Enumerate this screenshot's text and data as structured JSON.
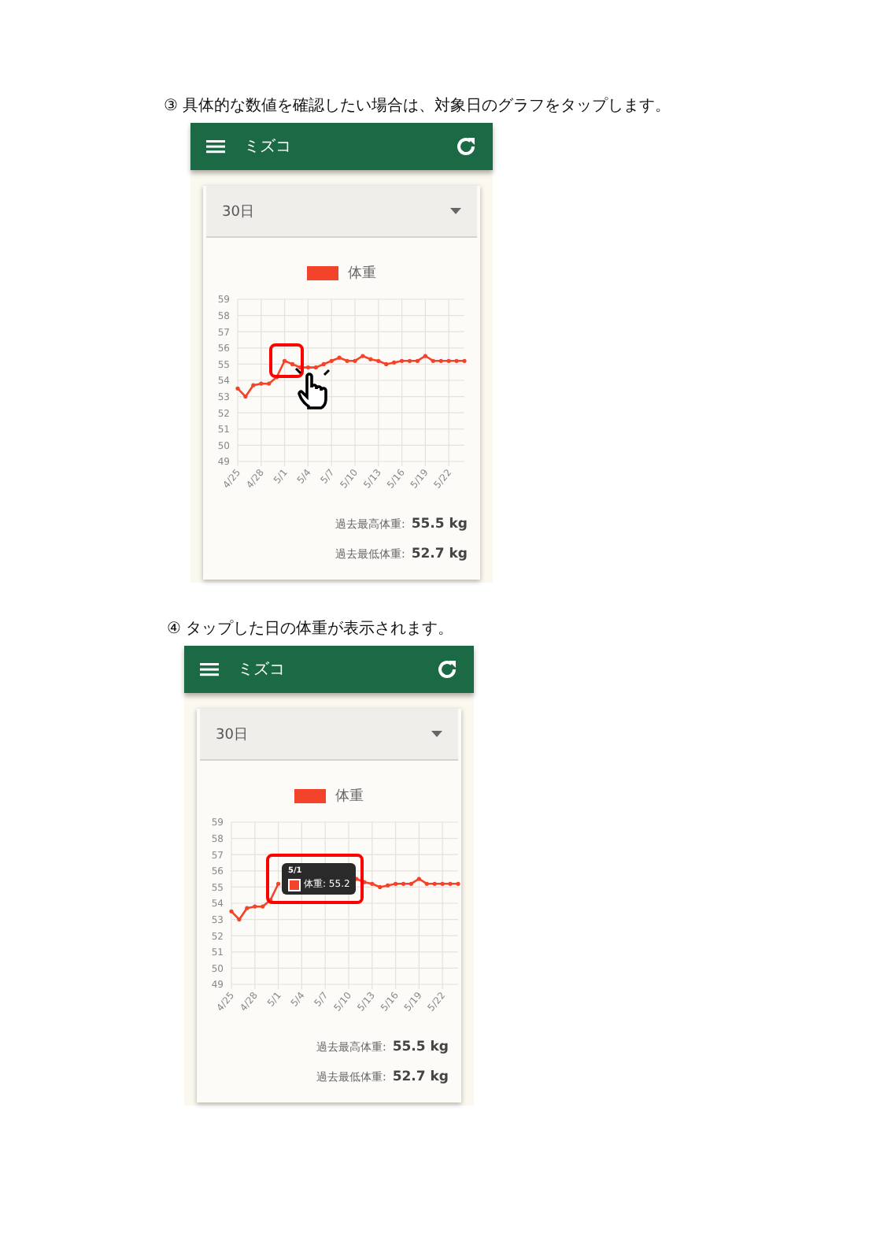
{
  "steps": [
    {
      "caption": "③ 具体的な数値を確認したい場合は、対象日のグラフをタップします。",
      "app": {
        "title": "ミズコ",
        "period": "30日",
        "chart_data": {
          "type": "line",
          "grid": true,
          "categories": [
            "4/25",
            null,
            null,
            "4/28",
            null,
            null,
            "5/1",
            null,
            null,
            "5/4",
            null,
            null,
            "5/7",
            null,
            null,
            "5/10",
            null,
            null,
            "5/13",
            null,
            null,
            "5/16",
            null,
            null,
            "5/19",
            null,
            null,
            "5/22",
            null,
            null
          ],
          "yticks": [
            49,
            50,
            51,
            52,
            53,
            54,
            55,
            56,
            57,
            58,
            59
          ],
          "ylim": [
            49,
            59
          ],
          "series": [
            {
              "name": "体重",
              "color": "#f4432b",
              "values": [
                53.5,
                53.0,
                53.7,
                53.8,
                53.8,
                54.2,
                55.2,
                55.0,
                54.8,
                54.8,
                54.8,
                55.0,
                55.2,
                55.4,
                55.2,
                55.2,
                55.5,
                55.3,
                55.2,
                55.0,
                55.1,
                55.2,
                55.2,
                55.2,
                55.5,
                55.2,
                55.2,
                55.2,
                55.2,
                55.2
              ]
            }
          ]
        },
        "stats": [
          {
            "label": "過去最高体重:",
            "value": "55.5 kg"
          },
          {
            "label": "過去最低体重:",
            "value": "52.7 kg"
          }
        ]
      },
      "callout": {
        "kind": "hand"
      }
    },
    {
      "caption": "④ タップした日の体重が表示されます。",
      "app": {
        "title": "ミズコ",
        "period": "30日",
        "chart_data": {
          "type": "line",
          "grid": true,
          "categories": [
            "4/25",
            null,
            null,
            "4/28",
            null,
            null,
            "5/1",
            null,
            null,
            "5/4",
            null,
            null,
            "5/7",
            null,
            null,
            "5/10",
            null,
            null,
            "5/13",
            null,
            null,
            "5/16",
            null,
            null,
            "5/19",
            null,
            null,
            "5/22",
            null,
            null
          ],
          "yticks": [
            49,
            50,
            51,
            52,
            53,
            54,
            55,
            56,
            57,
            58,
            59
          ],
          "ylim": [
            49,
            59
          ],
          "series": [
            {
              "name": "体重",
              "color": "#f4432b",
              "values": [
                53.5,
                53.0,
                53.7,
                53.8,
                53.8,
                54.2,
                55.2,
                null,
                null,
                null,
                null,
                null,
                null,
                null,
                null,
                null,
                55.5,
                55.3,
                55.2,
                55.0,
                55.1,
                55.2,
                55.2,
                55.2,
                55.5,
                55.2,
                55.2,
                55.2,
                55.2,
                55.2
              ]
            }
          ]
        },
        "stats": [
          {
            "label": "過去最高体重:",
            "value": "55.5 kg"
          },
          {
            "label": "過去最低体重:",
            "value": "52.7 kg"
          }
        ]
      },
      "callout": {
        "kind": "tooltip",
        "title": "5/1",
        "text": "体重: 55.2"
      }
    }
  ]
}
